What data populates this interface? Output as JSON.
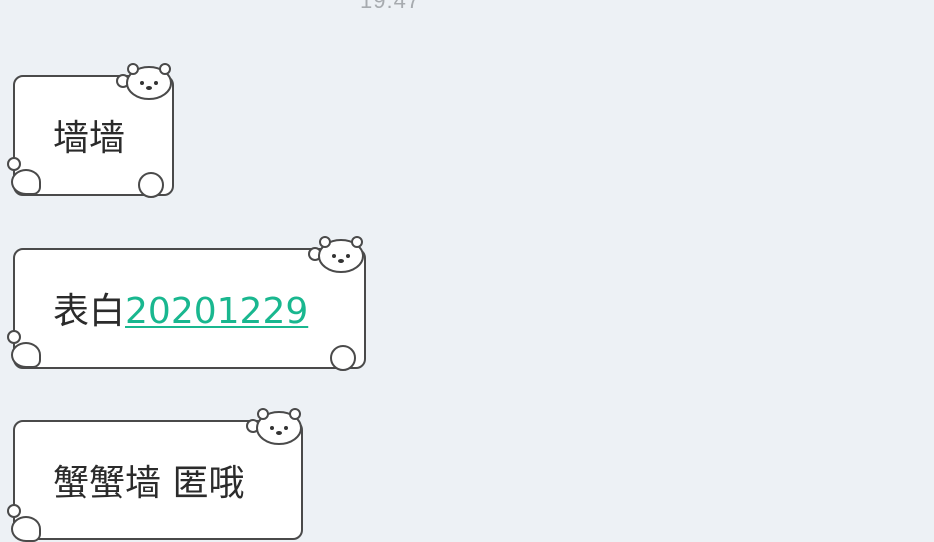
{
  "time": "19:47",
  "messages": [
    {
      "text": "墙墙",
      "link": ""
    },
    {
      "text": "表白",
      "link": "20201229"
    },
    {
      "text": "蟹蟹墙 匿哦",
      "link": ""
    }
  ],
  "colors": {
    "background": "#edf1f5",
    "bubble": "#ffffff",
    "outline": "#4a4a4a",
    "link": "#19b78f",
    "text": "#2b2b2b"
  },
  "icons": [
    "polar-bear-icon"
  ]
}
